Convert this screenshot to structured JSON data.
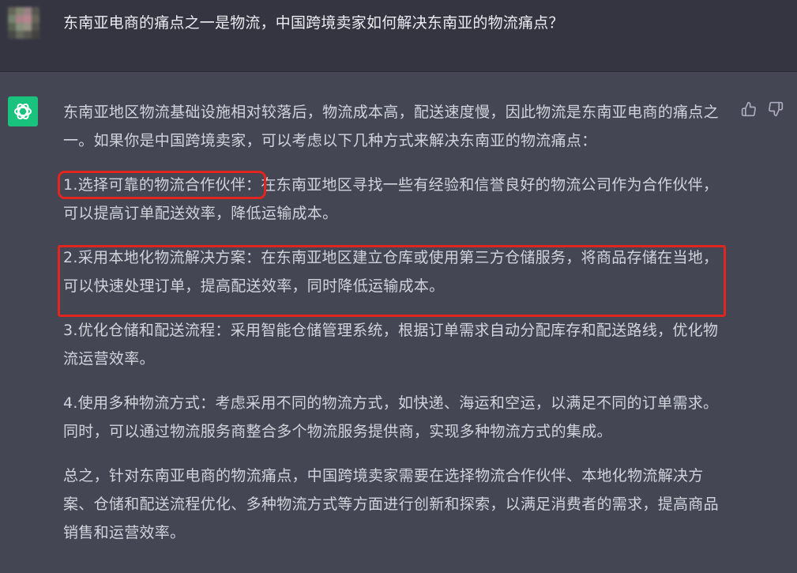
{
  "conversation": {
    "user_message": "东南亚电商的痛点之一是物流，中国跨境卖家如何解决东南亚的物流痛点？",
    "answer": {
      "intro": "东南亚地区物流基础设施相对较落后，物流成本高，配送速度慢，因此物流是东南亚电商的痛点之一。如果你是中国跨境卖家，可以考虑以下几种方式来解决东南亚的物流痛点：",
      "items": [
        {
          "heading": "1.选择可靠的物流合作伙伴：",
          "body": "在东南亚地区寻找一些有经验和信誉良好的物流公司作为合作伙伴，可以提高订单配送效率，降低运输成本。"
        },
        {
          "heading": "2.采用本地化物流解决方案：",
          "body": "在东南亚地区建立仓库或使用第三方仓储服务，将商品存储在当地，可以快速处理订单，提高配送效率，同时降低运输成本。"
        },
        {
          "heading": "3.优化仓储和配送流程：",
          "body": "采用智能仓储管理系统，根据订单需求自动分配库存和配送路线，优化物流运营效率。"
        },
        {
          "heading": "4.使用多种物流方式：",
          "body": "考虑采用不同的物流方式，如快递、海运和空运，以满足不同的订单需求。同时，可以通过物流服务商整合多个物流服务提供商，实现多种物流方式的集成。"
        }
      ],
      "conclusion": "总之，针对东南亚电商的物流痛点，中国跨境卖家需要在选择物流合作伙伴、本地化物流解决方案、仓储和配送流程优化、多种物流方式等方面进行创新和探索，以满足消费者的需求，提高商品销售和运营效率。"
    }
  },
  "icons": {
    "bot_avatar": "openai-logo-icon",
    "thumbs_up": "thumbs-up-icon",
    "thumbs_down": "thumbs-down-icon"
  },
  "colors": {
    "user_bg": "#343541",
    "assistant_bg": "#444654",
    "bot_avatar_bg": "#19c37d",
    "highlight_red": "#e0261e"
  }
}
